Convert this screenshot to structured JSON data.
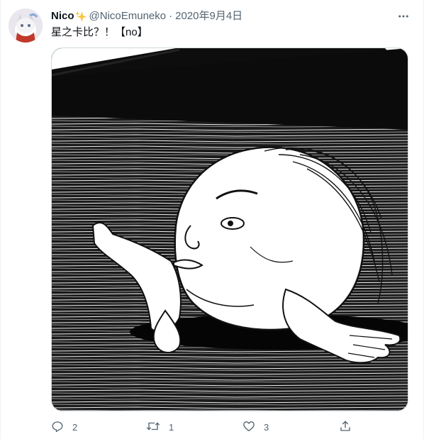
{
  "tweet": {
    "display_name": "Nico",
    "handle": "@NicoEmuneko",
    "separator": "·",
    "date": "2020年9月4日",
    "text": "星之卡比？！【no】",
    "icons": {
      "verified_sparkle": "sparkle-icon",
      "more": "more-icon",
      "reply": "reply-icon",
      "retweet": "retweet-icon",
      "like": "heart-icon",
      "share": "share-icon"
    }
  },
  "actions": {
    "reply_count": "2",
    "retweet_count": "1",
    "like_count": "3"
  },
  "colors": {
    "text_primary": "#0f1419",
    "text_secondary": "#536471",
    "sparkle": "#f6c643",
    "border": "#cfd9de"
  }
}
